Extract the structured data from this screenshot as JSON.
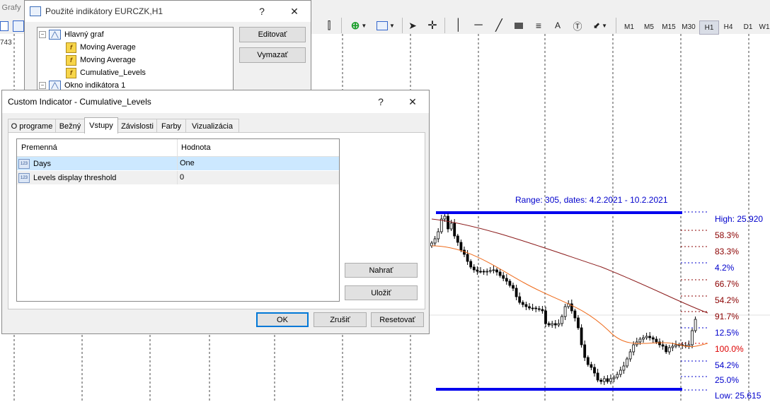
{
  "toolbar": {
    "menu_grafy": "Grafy",
    "timeframes": [
      "M1",
      "M5",
      "M15",
      "M30",
      "H1",
      "H4",
      "D1",
      "W1"
    ],
    "active_timeframe": "H1",
    "text_tool": "A",
    "left_value": "743"
  },
  "chart": {
    "range_label": "Range: 305, dates: 4.2.2021 - 10.2.2021",
    "high_label": "High: 25.920",
    "low_label": "Low: 25.615",
    "levels": [
      "58.3%",
      "83.3%",
      "4.2%",
      "66.7%",
      "54.2%",
      "91.7%",
      "12.5%",
      "100.0%",
      "54.2%",
      "25.0%"
    ],
    "level_colors": [
      "#8b0000",
      "#8b0000",
      "#0000cc",
      "#8b0000",
      "#8b0000",
      "#8b0000",
      "#0000cc",
      "#dd0000",
      "#0000cc",
      "#0000cc"
    ],
    "colors": {
      "range_bar": "#0000ee",
      "ma_slow": "#8b1a1a",
      "ma_fast": "#ee6a1a",
      "label_blue": "#0000cc"
    }
  },
  "indicators_window": {
    "title": "Použité indikátory EURCZK,H1",
    "help": "?",
    "close": "✕",
    "tree": {
      "main_chart": "Hlavný graf",
      "items": [
        "Moving Average",
        "Moving Average",
        "Cumulative_Levels"
      ],
      "indicator_window": "Okno indikátora 1"
    },
    "edit_button": "Editovať",
    "delete_button": "Vymazať"
  },
  "custom_indicator": {
    "title": "Custom Indicator - Cumulative_Levels",
    "help": "?",
    "close": "✕",
    "tabs": [
      "O programe",
      "Bežný",
      "Vstupy",
      "Závislosti",
      "Farby",
      "Vizualizácia"
    ],
    "active_tab": "Vstupy",
    "table": {
      "headers": [
        "Premenná",
        "Hodnota"
      ],
      "rows": [
        {
          "name": "Days",
          "value": "One"
        },
        {
          "name": "Levels display threshold",
          "value": "0"
        }
      ]
    },
    "load_button": "Nahrať",
    "save_button": "Uložiť",
    "ok_button": "OK",
    "cancel_button": "Zrušiť",
    "reset_button": "Resetovať"
  }
}
